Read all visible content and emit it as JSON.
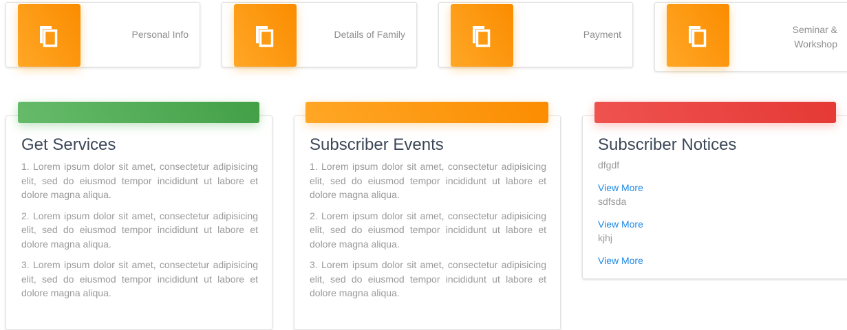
{
  "tiles": [
    {
      "label_lines": [
        "Personal Info"
      ],
      "icon": "copy-icon"
    },
    {
      "label_lines": [
        "Details of Family"
      ],
      "icon": "copy-icon"
    },
    {
      "label_lines": [
        "Payment"
      ],
      "icon": "copy-icon"
    },
    {
      "label_lines": [
        "Seminar &",
        "Workshop"
      ],
      "icon": "copy-icon"
    }
  ],
  "services": {
    "title": "Get Services",
    "items": [
      "1. Lorem ipsum dolor sit amet, consectetur adipisicing elit, sed do eiusmod tempor incididunt ut labore et dolore magna aliqua.",
      "2. Lorem ipsum dolor sit amet, consectetur adipisicing elit, sed do eiusmod tempor incididunt ut labore et dolore magna aliqua.",
      "3. Lorem ipsum dolor sit amet, consectetur adipisicing elit, sed do eiusmod tempor incididunt ut labore et dolore magna aliqua."
    ]
  },
  "events": {
    "title": "Subscriber Events",
    "items": [
      "1. Lorem ipsum dolor sit amet, consectetur adipisicing elit, sed do eiusmod tempor incididunt ut labore et dolore magna aliqua.",
      "2. Lorem ipsum dolor sit amet, consectetur adipisicing elit, sed do eiusmod tempor incididunt ut labore et dolore magna aliqua.",
      "3. Lorem ipsum dolor sit amet, consectetur adipisicing elit, sed do eiusmod tempor incididunt ut labore et dolore magna aliqua."
    ]
  },
  "notices": {
    "title": "Subscriber Notices",
    "items": [
      {
        "text": "dfgdf",
        "link": "View More"
      },
      {
        "text": "sdfsda",
        "link": "View More"
      },
      {
        "text": "kjhj",
        "link": "View More"
      }
    ]
  },
  "colors": {
    "orange": "#fb8c00",
    "green": "#43a047",
    "red": "#e53935",
    "link": "#1e88e5"
  }
}
